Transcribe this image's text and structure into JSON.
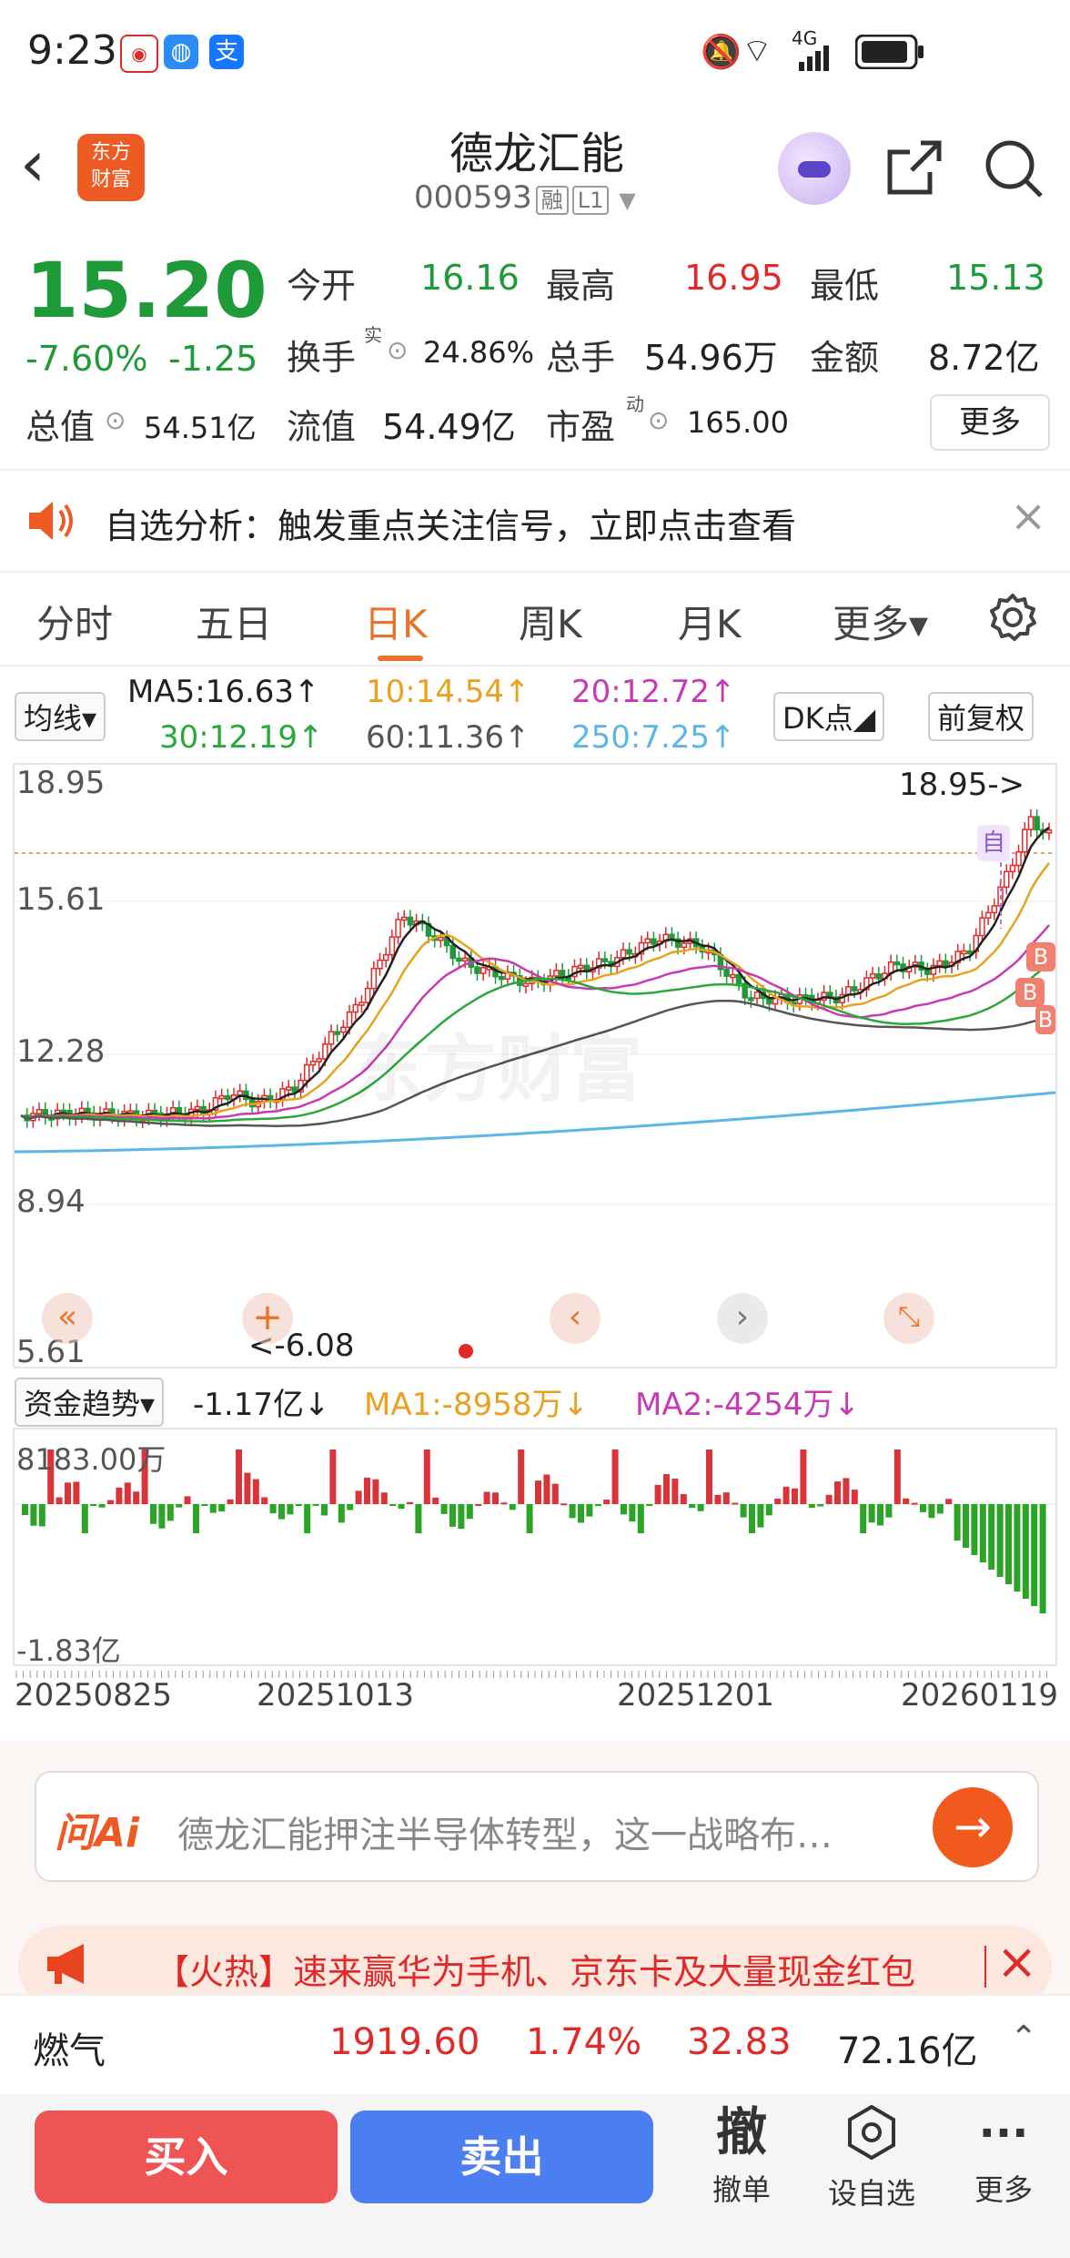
{
  "status_bar": {
    "time": "9:23",
    "network": "4G"
  },
  "nav": {
    "title": "德龙汇能",
    "code": "000593",
    "tag1": "融",
    "tag2": "L1",
    "logo": "东方\n财富"
  },
  "quote": {
    "price": "15.20",
    "change_pct": "-7.60%",
    "change": "-1.25",
    "open_label": "今开",
    "open": "16.16",
    "high_label": "最高",
    "high": "16.95",
    "low_label": "最低",
    "low": "15.13",
    "turnover_label": "换手",
    "turnover_sup": "实",
    "turnover": "24.86%",
    "volume_label": "总手",
    "volume": "54.96万",
    "amount_label": "金额",
    "amount": "8.72亿",
    "mktcap_label": "总值",
    "mktcap": "54.51亿",
    "float_label": "流值",
    "float": "54.49亿",
    "pe_label": "市盈",
    "pe_sup": "动",
    "pe": "165.00",
    "more": "更多"
  },
  "notice": {
    "text": "自选分析：触发重点关注信号，立即点击查看"
  },
  "tabs": [
    {
      "label": "分时"
    },
    {
      "label": "五日"
    },
    {
      "label": "日K"
    },
    {
      "label": "周K"
    },
    {
      "label": "月K"
    },
    {
      "label": "更多▾"
    }
  ],
  "ma_bar": {
    "chip": "均线▾",
    "ma5": "MA5:16.63↑",
    "ma10": "10:14.54↑",
    "ma20": "20:12.72↑",
    "ma30": "30:12.19↑",
    "ma60": "60:11.36↑",
    "ma250": "250:7.25↑",
    "dk": "DK点◢",
    "adjust": "前复权"
  },
  "kline": {
    "y_ticks": [
      "18.95",
      "15.61",
      "12.28",
      "8.94",
      "5.61"
    ],
    "max_marker": "18.95->",
    "min_marker": "<-6.08",
    "self_marker": "自",
    "b_marker": "B",
    "watermark": "东方财富",
    "colors": {
      "up": "#e02a2a",
      "down": "#1e9b38",
      "ma5": "#222222",
      "ma10": "#e8a21f",
      "ma20": "#c83ab5",
      "ma30": "#2aa83a",
      "ma60": "#555555",
      "ma250": "#5bb6e6"
    }
  },
  "fund_flow": {
    "chip": "资金趋势▾",
    "value": "-1.17亿↓",
    "ma1": "MA1:-8958万↓",
    "ma2": "MA2:-4254万↓",
    "y_top": "8183.00万",
    "y_bottom": "-1.83亿"
  },
  "dates": [
    "20250825",
    "20251013",
    "20251201",
    "20260119"
  ],
  "ai": {
    "logo": "问Ai",
    "text": "德龙汇能押注半导体转型，这一战略布…"
  },
  "promo": {
    "text": "【火热】速来赢华为手机、京东卡及大量现金红包"
  },
  "sector": {
    "name": "燃气",
    "index": "1919.60",
    "pct": "1.74%",
    "change": "32.83",
    "amount": "72.16亿"
  },
  "bottom": {
    "buy": "买入",
    "sell": "卖出",
    "cancel_icon": "撤",
    "cancel": "撤单",
    "watch": "设自选",
    "more": "更多"
  }
}
